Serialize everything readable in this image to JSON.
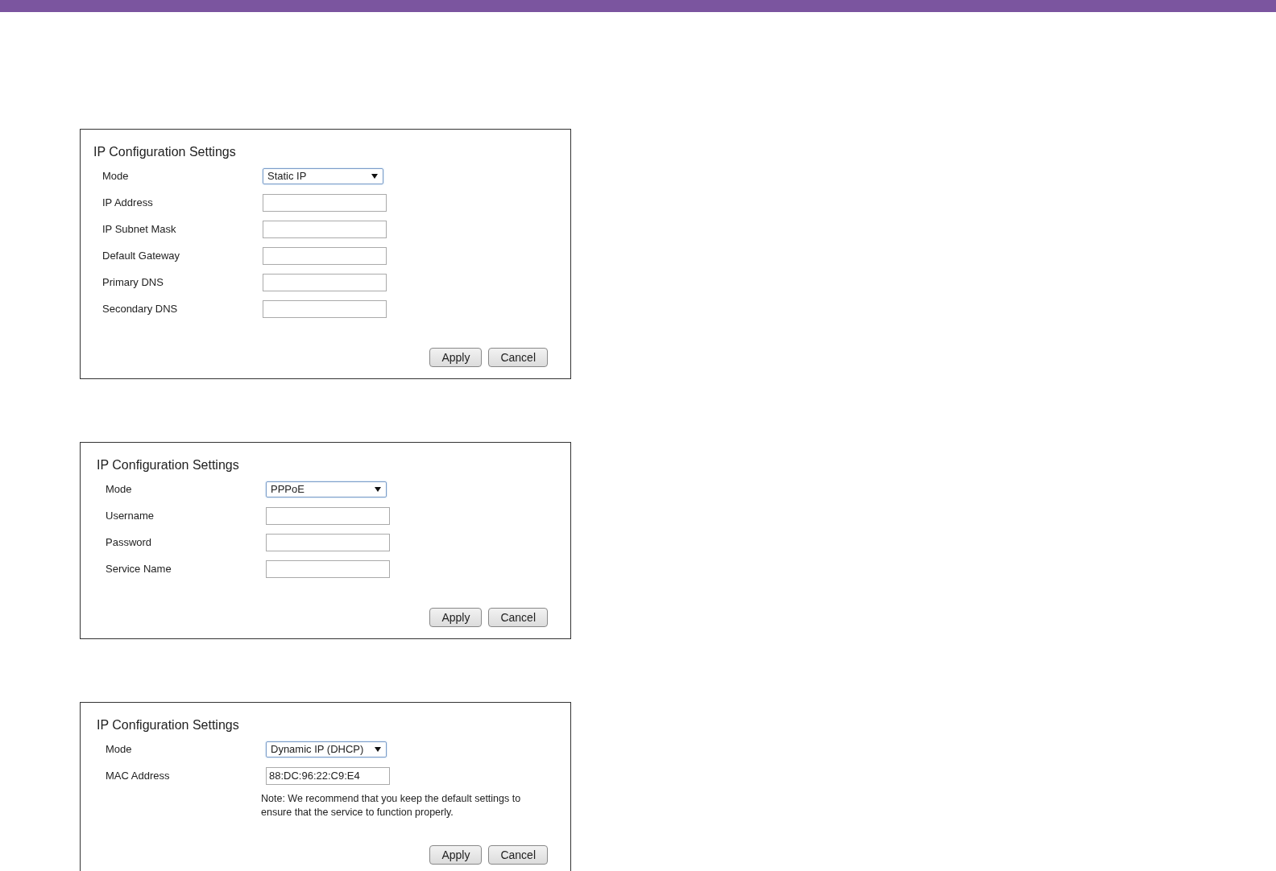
{
  "panels": [
    {
      "title": "IP Configuration Settings",
      "rows": [
        {
          "label": "Mode",
          "kind": "select",
          "value": "Static IP"
        },
        {
          "label": "IP Address",
          "kind": "input",
          "value": ""
        },
        {
          "label": "IP Subnet Mask",
          "kind": "input",
          "value": ""
        },
        {
          "label": "Default Gateway",
          "kind": "input",
          "value": ""
        },
        {
          "label": "Primary DNS",
          "kind": "input",
          "value": ""
        },
        {
          "label": "Secondary DNS",
          "kind": "input",
          "value": ""
        }
      ],
      "buttons": [
        "Apply",
        "Cancel"
      ]
    },
    {
      "title": "IP Configuration Settings",
      "rows": [
        {
          "label": "Mode",
          "kind": "select",
          "value": "PPPoE"
        },
        {
          "label": "Username",
          "kind": "input",
          "value": ""
        },
        {
          "label": "Password",
          "kind": "input",
          "value": ""
        },
        {
          "label": "Service Name",
          "kind": "input",
          "value": ""
        }
      ],
      "buttons": [
        "Apply",
        "Cancel"
      ]
    },
    {
      "title": "IP Configuration Settings",
      "rows": [
        {
          "label": "Mode",
          "kind": "select",
          "value": "Dynamic IP (DHCP)"
        },
        {
          "label": "MAC Address",
          "kind": "input",
          "value": "88:DC:96:22:C9:E4"
        }
      ],
      "note": "Note: We recommend that you keep the default settings to ensure that the service to function properly.",
      "buttons": [
        "Apply",
        "Cancel"
      ]
    }
  ]
}
